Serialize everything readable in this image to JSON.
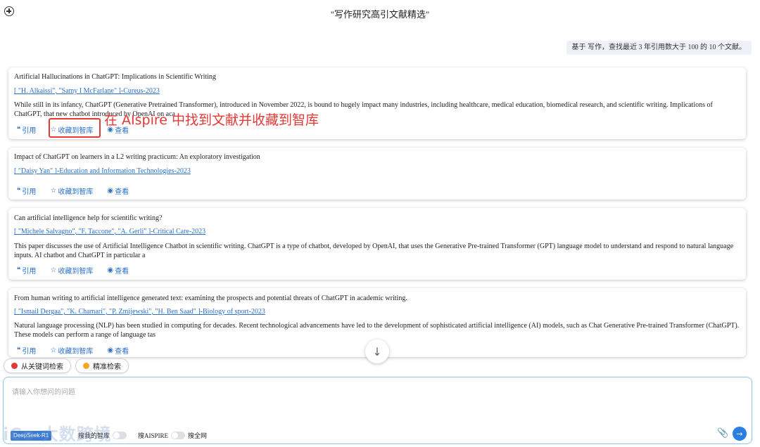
{
  "header": {
    "title": "\"写作研究高引文献精选\""
  },
  "user_message": "基于 写作，查找最近 3 年引用数大于 100 的 10 个文献。",
  "actions": {
    "cite": "引用",
    "favorite": "收藏到智库",
    "view": "查看"
  },
  "papers": [
    {
      "title": "Artificial Hallucinations in ChatGPT: Implications in Scientific Writing",
      "authors": "[ \"H. Alkaissi\", \"Samy I McFarlane\" ]-Cureus-2023",
      "abstract": "While still in its infancy, ChatGPT (Generative Pretrained Transformer), introduced in November 2022, is bound to hugely impact many industries, including healthcare, medical education, biomedical research, and scientific writing. Implications of ChatGPT, that new chatbot introduced by OpenAI on aca"
    },
    {
      "title": "Impact of ChatGPT on learners in a L2 writing practicum: An exploratory investigation",
      "authors": "[ \"Daisy Yan\" ]-Education and Information Technologies-2023",
      "abstract": ""
    },
    {
      "title": "Can artificial intelligence help for scientific writing?",
      "authors": "[ \"Michele Salvagno\", \"F. Taccone\", \"A. Gerli\" ]-Critical Care-2023",
      "abstract": "This paper discusses the use of Artificial Intelligence Chatbot in scientific writing. ChatGPT is a type of chatbot, developed by OpenAI, that uses the Generative Pre-trained Transformer (GPT) language model to understand and respond to natural language inputs. AI chatbot and ChatGPT in particular a"
    },
    {
      "title": "From human writing to artificial intelligence generated text: examining the prospects and potential threats of ChatGPT in academic writing.",
      "authors": "[ \"Ismail Dergaa\", \"K. Chamari\", \"P. Zmijewski\", \"H. Ben Saad\" ]-Biology of sport-2023",
      "abstract": "Natural language processing (NLP) has been studied in computing for decades. Recent technological advancements have led to the development of sophisticated artificial intelligence (AI) models, such as Chat Generative Pre-trained Transformer (ChatGPT). These models can perform a range of language tas"
    }
  ],
  "annotation": "在 AIspire 中找到文献并收藏到智库",
  "search_modes": {
    "keyword": "从关键词检索",
    "precise": "精准检索",
    "keyword_color": "#e53935",
    "precise_color": "#f5a623"
  },
  "input": {
    "placeholder": "请输入你想问的问题",
    "model_label": "DeepSeek-R1",
    "toggle_library": "搜我的智库",
    "toggle_aispire": "搜AISPIRE",
    "toggle_web": "搜全网"
  },
  "watermark": "iCo 大数跨境"
}
